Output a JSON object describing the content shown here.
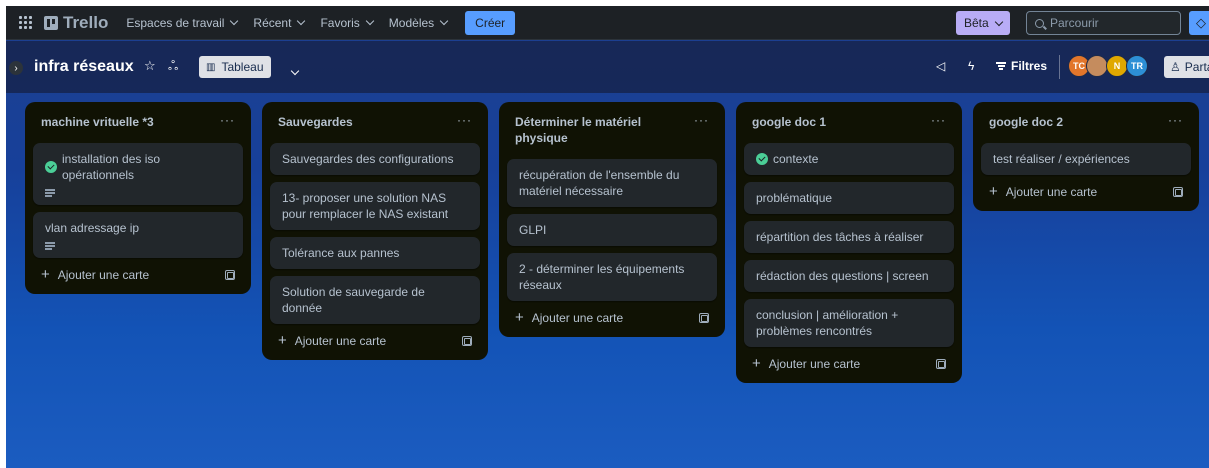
{
  "topnav": {
    "logo": "Trello",
    "menus": [
      "Espaces de travail",
      "Récent",
      "Favoris",
      "Modèles"
    ],
    "create_label": "Créer",
    "beta_label": "Bêta",
    "search_placeholder": "Parcourir"
  },
  "board": {
    "title": "infra réseaux",
    "view_label": "Tableau",
    "filters_label": "Filtres",
    "share_label": "Parta",
    "members": [
      {
        "initials": "TC",
        "color": "#e2762b"
      },
      {
        "initials": "",
        "color": "#c58c5e"
      },
      {
        "initials": "N",
        "color": "#e0a800"
      },
      {
        "initials": "TR",
        "color": "#2d8fd5"
      }
    ]
  },
  "add_card_label": "Ajouter une carte",
  "lists": [
    {
      "title": "machine vrituelle *3",
      "cards": [
        {
          "text": "installation des iso opérationnels",
          "done": true,
          "has_description": true
        },
        {
          "text": "vlan adressage ip",
          "done": false,
          "has_description": true
        }
      ]
    },
    {
      "title": "Sauvegardes",
      "cards": [
        {
          "text": "Sauvegardes des configurations"
        },
        {
          "text": "13- proposer une solution NAS pour remplacer le NAS existant"
        },
        {
          "text": "Tolérance aux pannes"
        },
        {
          "text": "Solution de sauvegarde de donnée"
        }
      ]
    },
    {
      "title": "Déterminer le matériel physique",
      "cards": [
        {
          "text": "récupération de l'ensemble du matériel nécessaire"
        },
        {
          "text": "GLPI"
        },
        {
          "text": "2 - déterminer les équipements réseaux"
        }
      ]
    },
    {
      "title": "google doc 1",
      "cards": [
        {
          "text": "contexte",
          "done": true
        },
        {
          "text": "problématique"
        },
        {
          "text": "répartition des tâches à réaliser"
        },
        {
          "text": "rédaction des questions | screen"
        },
        {
          "text": "conclusion | amélioration + problèmes rencontrés"
        }
      ]
    },
    {
      "title": "google doc 2",
      "cards": [
        {
          "text": "test réaliser / expériences"
        }
      ]
    }
  ]
}
